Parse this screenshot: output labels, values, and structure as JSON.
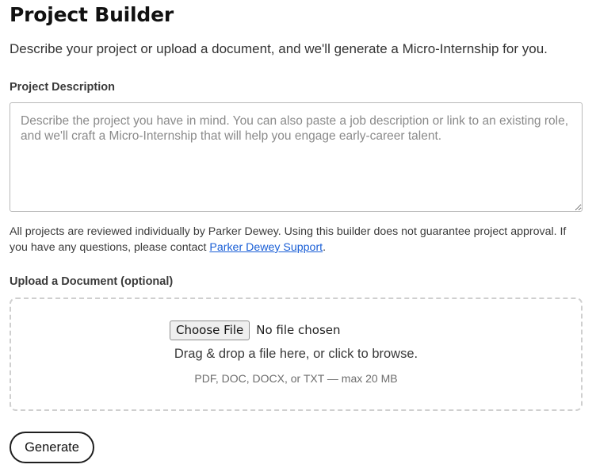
{
  "header": {
    "title": "Project Builder",
    "subtitle": "Describe your project or upload a document, and we'll generate a Micro-Internship for you."
  },
  "description": {
    "label": "Project Description",
    "value": "",
    "placeholder": "Describe the project you have in mind. You can also paste a job description or link to an existing role, and we'll craft a Micro-Internship that will help you engage early-career talent."
  },
  "notice": {
    "text": "All projects are reviewed individually by Parker Dewey. Using this builder does not guarantee project approval. If you have any questions, please contact ",
    "link_text": "Parker Dewey Support",
    "suffix": "."
  },
  "upload": {
    "label": "Upload a Document (optional)",
    "choose_button": "Choose File",
    "file_status": "No file chosen",
    "drag_text": "Drag & drop a file here, or click to browse.",
    "hint": "PDF, DOC, DOCX, or TXT — max 20 MB"
  },
  "actions": {
    "generate_label": "Generate"
  }
}
